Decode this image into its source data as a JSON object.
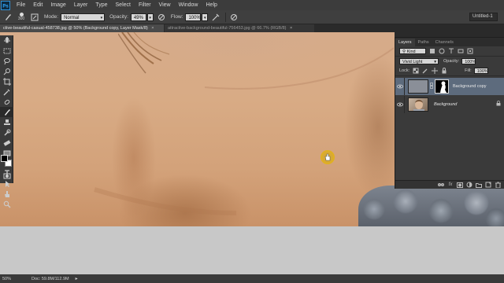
{
  "menubar": {
    "logo": "Ps",
    "items": [
      "File",
      "Edit",
      "Image",
      "Layer",
      "Type",
      "Select",
      "Filter",
      "View",
      "Window",
      "Help"
    ]
  },
  "options": {
    "brush_size": "300",
    "mode_label": "Mode:",
    "mode_value": "Normal",
    "opacity_label": "Opacity:",
    "opacity_value": "49%",
    "flow_label": "Flow:",
    "flow_value": "100%",
    "workspace": "Untitled-1"
  },
  "tabs": {
    "active": "ctive-beautiful-casual-458738.jpg @ 50% (Background copy, Layer Mask/8)",
    "inactive": "attractive-background-beautiful-756453.jpg @ 66.7% (RGB/8)",
    "close_glyph": "×"
  },
  "layers_panel": {
    "tabs": [
      "Layers",
      "Paths",
      "Channels"
    ],
    "kind_label": "Kind",
    "blend_mode": "Vivid Light",
    "opacity_label": "Opacity:",
    "opacity_value": "100%",
    "lock_label": "Lock:",
    "fill_label": "Fill:",
    "fill_value": "100%",
    "layers": [
      {
        "name": "Background copy",
        "selected": true
      },
      {
        "name": "Background",
        "selected": false
      }
    ]
  },
  "status": {
    "zoom": "50%",
    "doc": "Doc: 59.8M/112.9M",
    "arrow": "▸"
  },
  "colors": {
    "accent_selected": "#5d6b7d",
    "cursor": "#e0b020"
  }
}
